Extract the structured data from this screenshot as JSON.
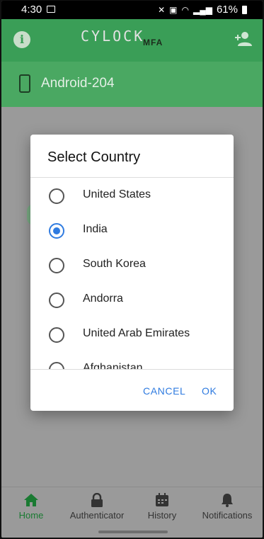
{
  "status_bar": {
    "time": "4:30",
    "battery": "61%"
  },
  "app_bar": {
    "logo_text": "CYLOCK",
    "logo_sub": "MFA"
  },
  "device": {
    "name": "Android-204"
  },
  "dialog": {
    "title": "Select Country",
    "options": [
      {
        "label": "United States",
        "selected": false
      },
      {
        "label": "India",
        "selected": true
      },
      {
        "label": "South Korea",
        "selected": false
      },
      {
        "label": "Andorra",
        "selected": false
      },
      {
        "label": "United Arab Emirates",
        "selected": false
      },
      {
        "label": "Afghanistan",
        "selected": false
      }
    ],
    "cancel_label": "CANCEL",
    "ok_label": "OK"
  },
  "bottom_nav": {
    "items": [
      {
        "label": "Home",
        "icon": "home-icon",
        "active": true
      },
      {
        "label": "Authenticator",
        "icon": "lock-icon",
        "active": false
      },
      {
        "label": "History",
        "icon": "calendar-icon",
        "active": false
      },
      {
        "label": "Notifications",
        "icon": "bell-icon",
        "active": false
      }
    ]
  },
  "colors": {
    "primary": "#3a9e57",
    "accent": "#2f7be0",
    "active_nav": "#1a7a32"
  }
}
